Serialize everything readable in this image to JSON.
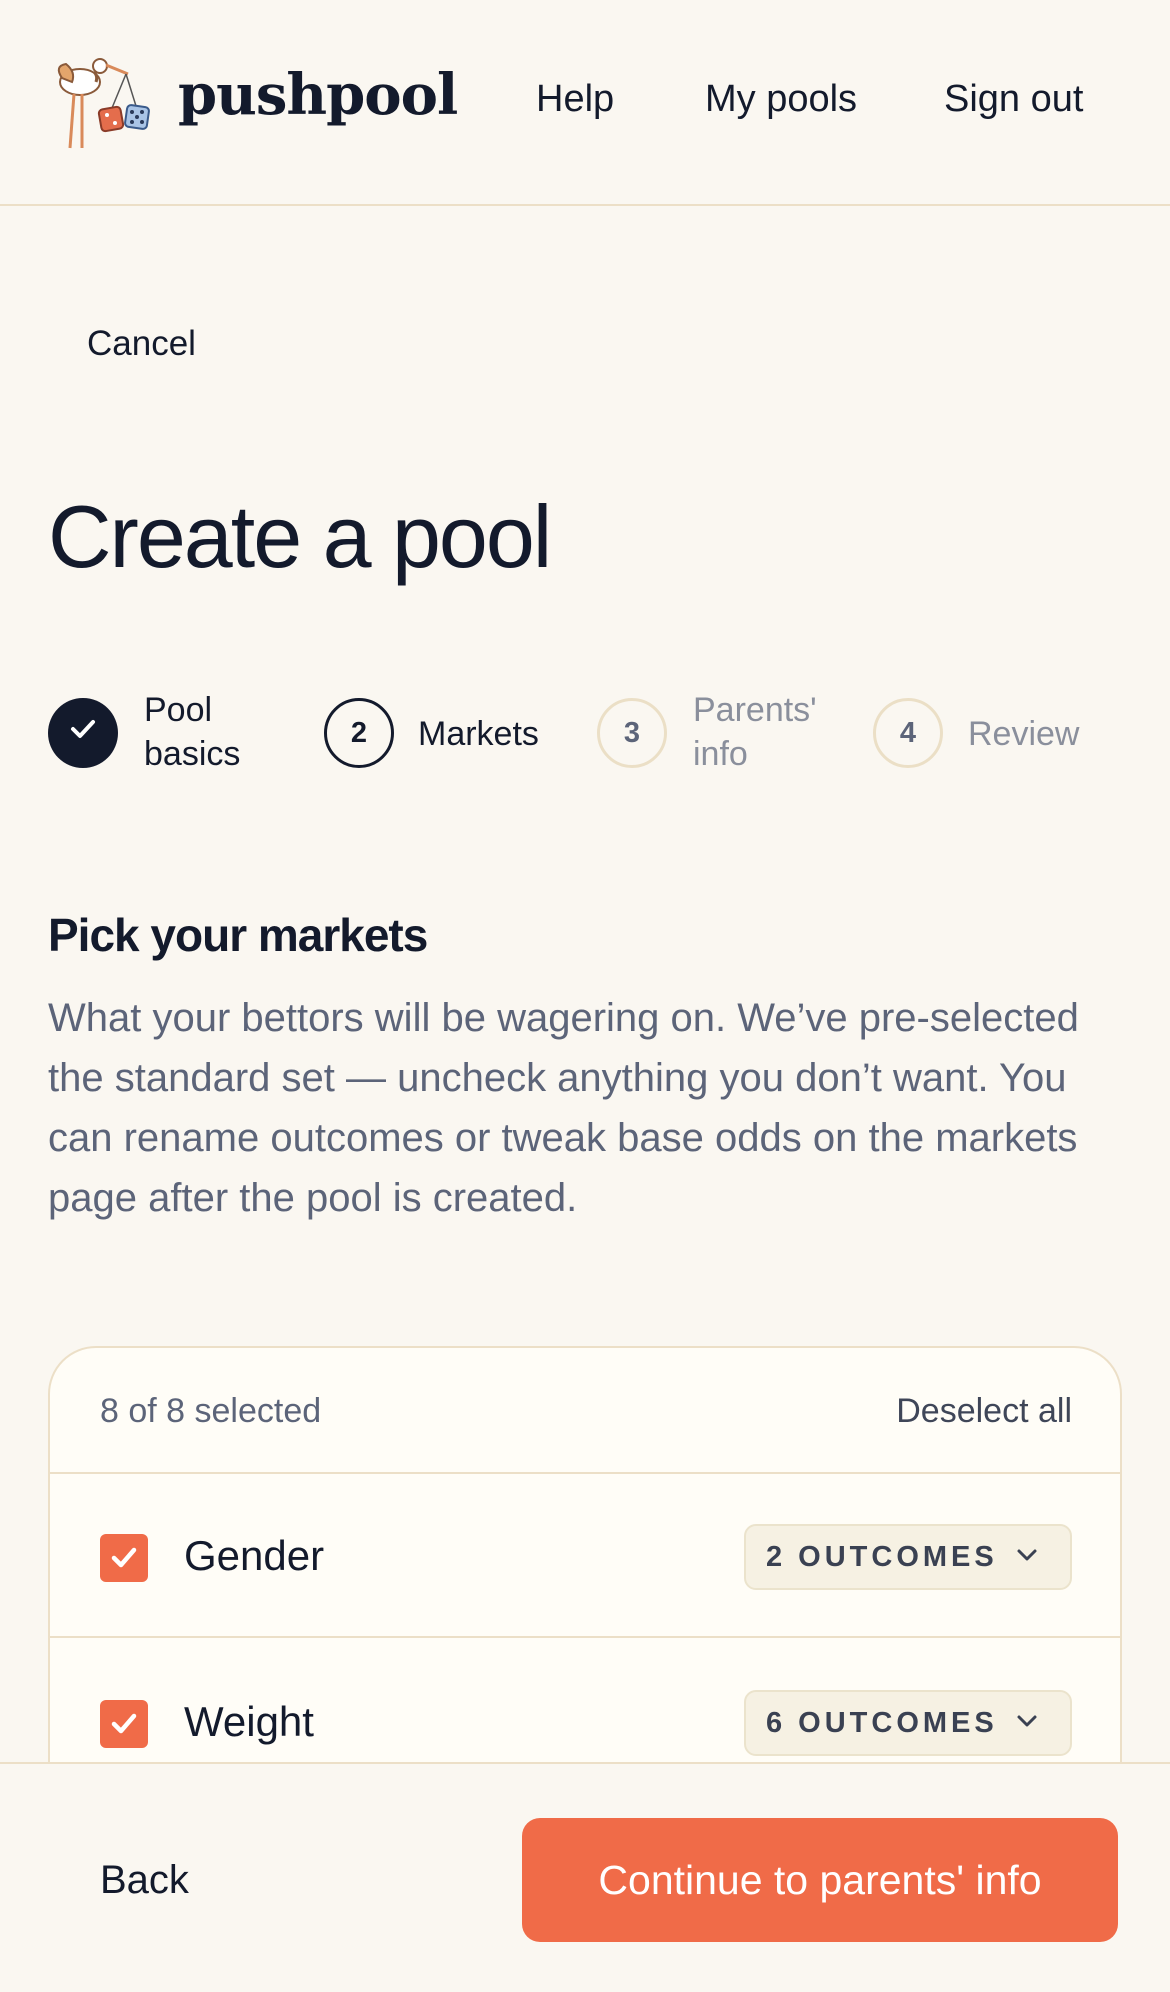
{
  "header": {
    "logo_text": "pushpool",
    "nav": {
      "help": "Help",
      "my_pools": "My pools",
      "sign_out": "Sign out"
    }
  },
  "cancel_label": "Cancel",
  "page_title": "Create a pool",
  "stepper": {
    "steps": [
      {
        "number": "",
        "label_line1": "Pool",
        "label_line2": "basics",
        "state": "complete"
      },
      {
        "number": "2",
        "label_line1": "Markets",
        "label_line2": "",
        "state": "current"
      },
      {
        "number": "3",
        "label_line1": "Parents'",
        "label_line2": "info",
        "state": "upcoming"
      },
      {
        "number": "4",
        "label_line1": "Review",
        "label_line2": "",
        "state": "upcoming"
      }
    ]
  },
  "section": {
    "title": "Pick your markets",
    "description": "What your bettors will be wagering on. We’ve pre-selected the standard set — uncheck anything you don’t want. You can rename outcomes or tweak base odds on the markets page after the pool is created."
  },
  "markets": {
    "selected_count": "8 of 8 selected",
    "deselect_all": "Deselect all",
    "items": [
      {
        "label": "Gender",
        "checked": true,
        "outcomes": "2 OUTCOMES"
      },
      {
        "label": "Weight",
        "checked": true,
        "outcomes": "6 OUTCOMES"
      }
    ]
  },
  "footer": {
    "back": "Back",
    "continue": "Continue to parents' info"
  },
  "colors": {
    "accent": "#f06b48",
    "ink": "#131a2c",
    "muted": "#5c6479",
    "background": "#faf7f1",
    "border": "#ecdfc7"
  }
}
